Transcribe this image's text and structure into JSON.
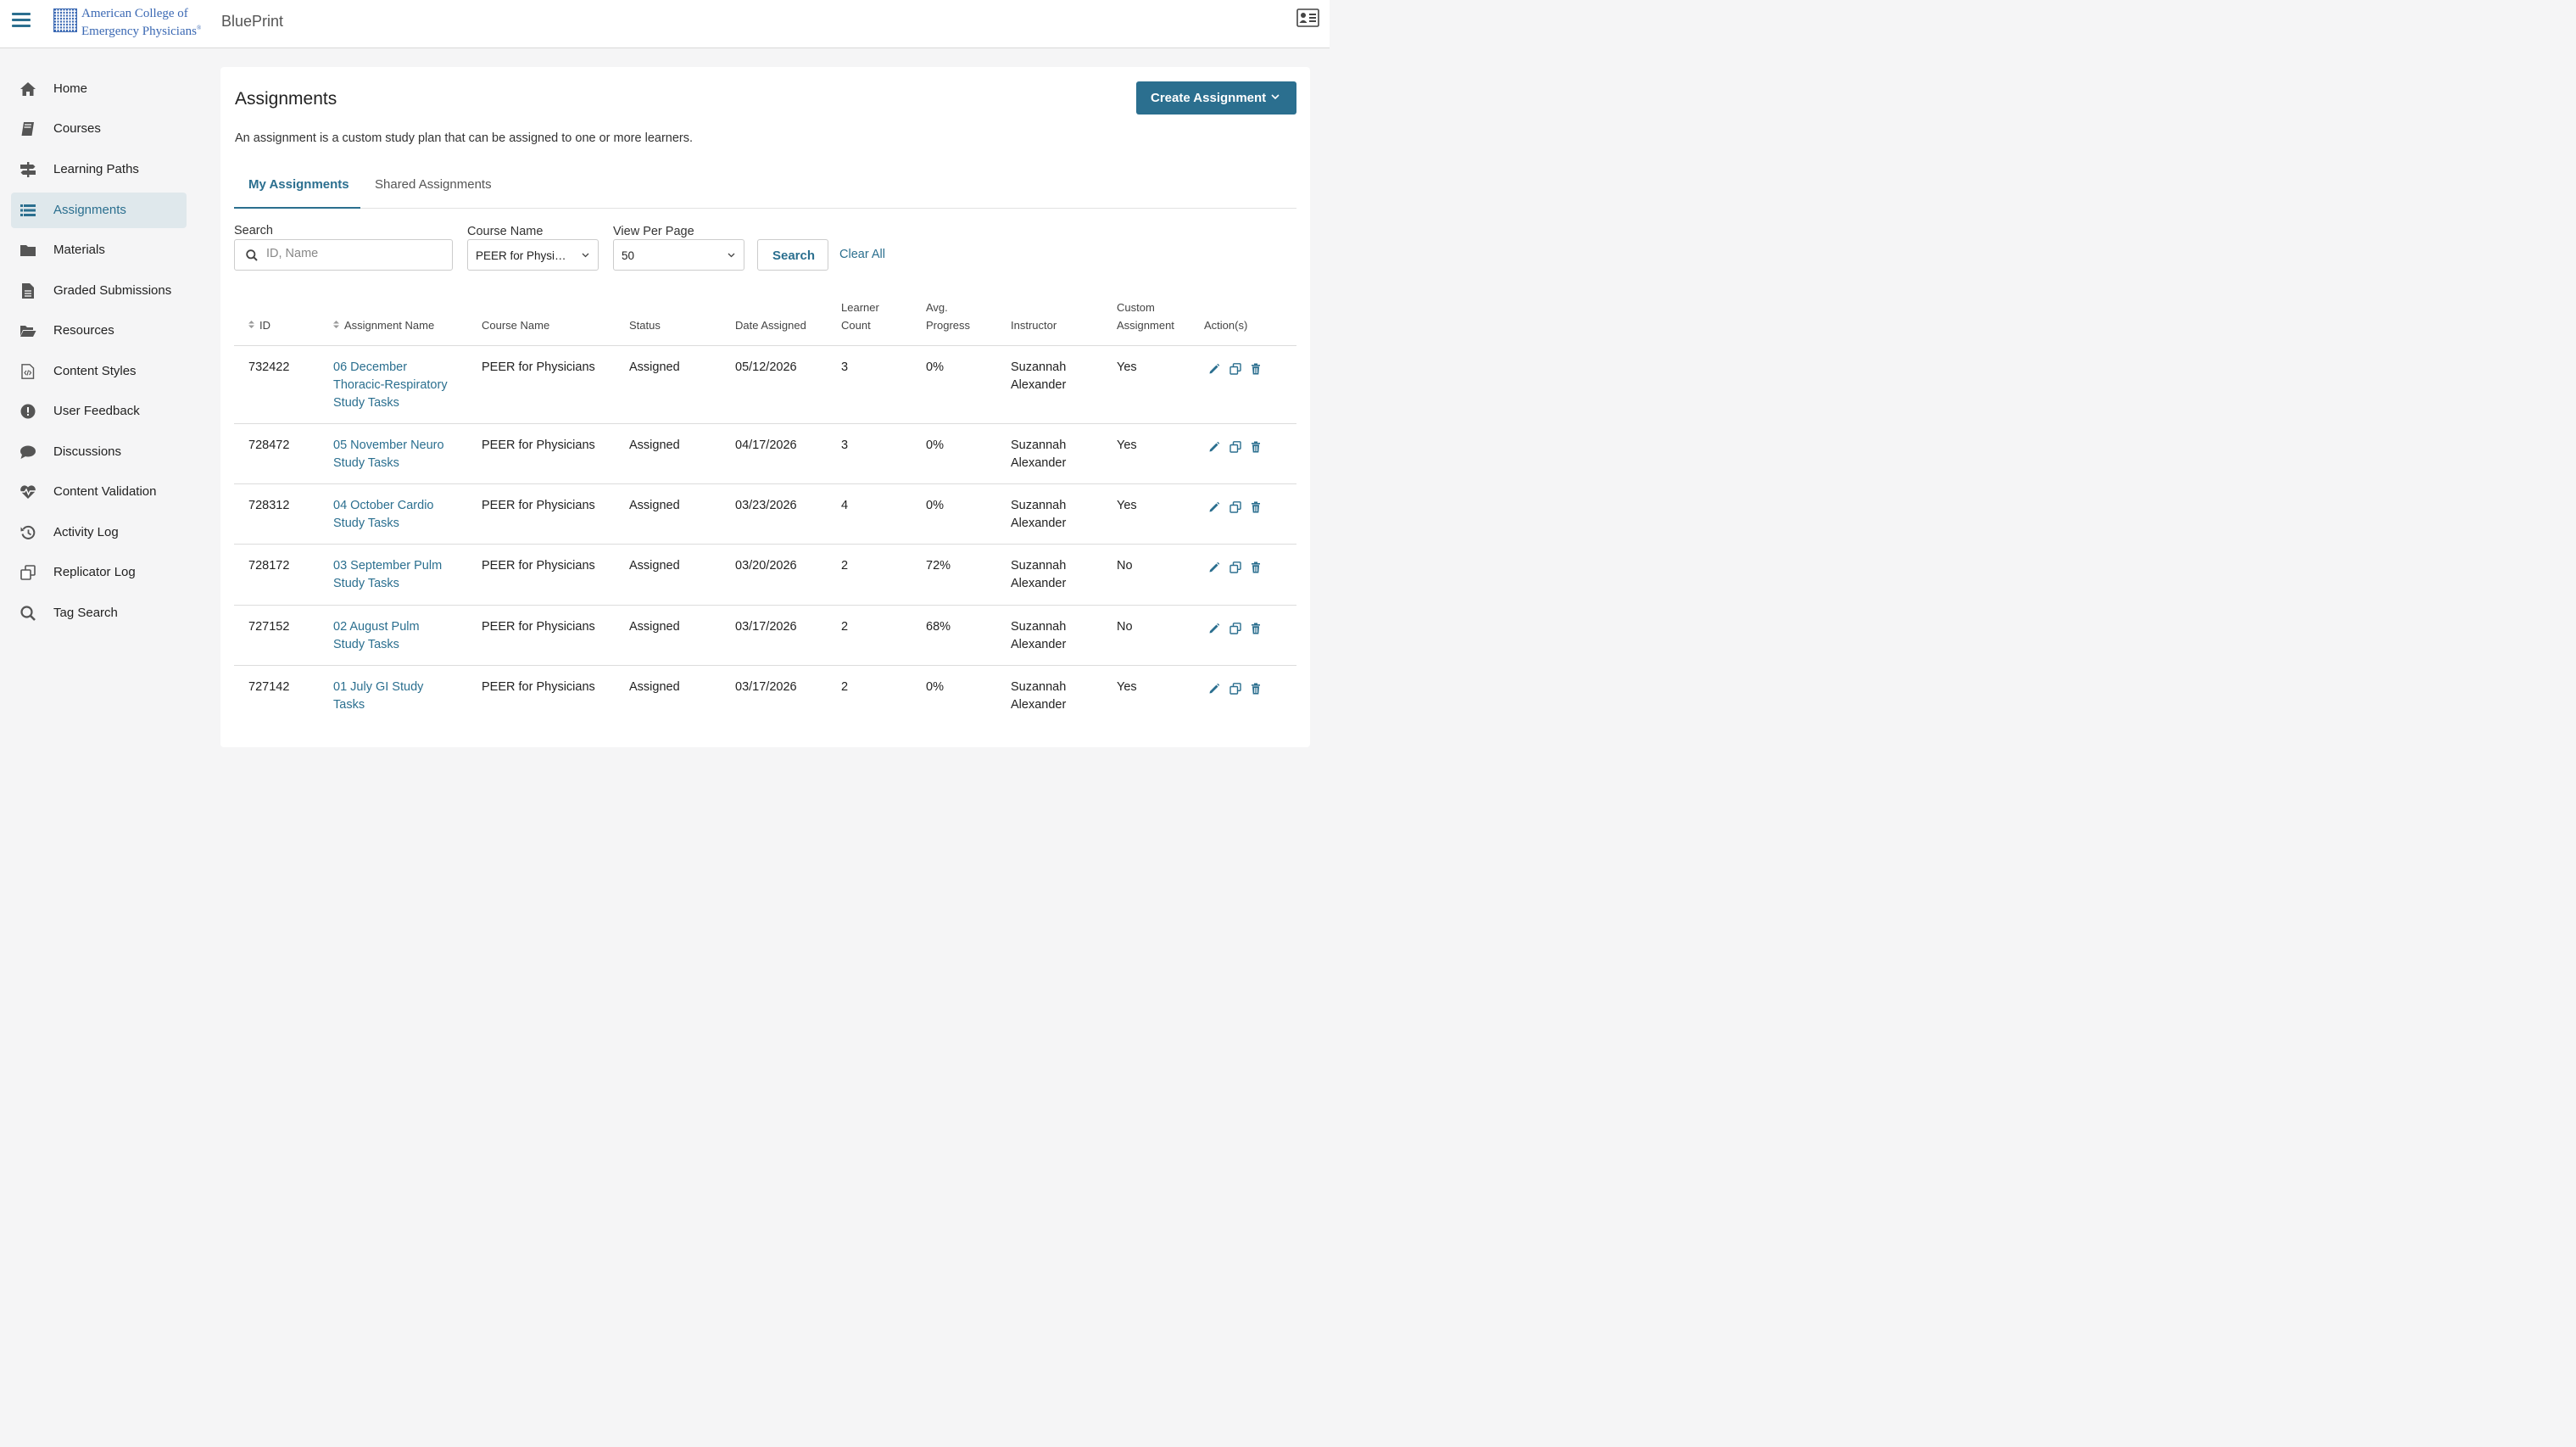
{
  "header": {
    "logo_line1": "American College of",
    "logo_line2": "Emergency Physicians",
    "logo_reg": "®",
    "app_name": "BluePrint"
  },
  "sidebar": {
    "items": [
      {
        "label": "Home",
        "icon": "home-icon"
      },
      {
        "label": "Courses",
        "icon": "book-icon"
      },
      {
        "label": "Learning Paths",
        "icon": "signpost-icon"
      },
      {
        "label": "Assignments",
        "icon": "list-icon",
        "active": true
      },
      {
        "label": "Materials",
        "icon": "folder-icon"
      },
      {
        "label": "Graded Submissions",
        "icon": "document-icon"
      },
      {
        "label": "Resources",
        "icon": "folder-open-icon"
      },
      {
        "label": "Content Styles",
        "icon": "code-file-icon"
      },
      {
        "label": "User Feedback",
        "icon": "exclamation-icon"
      },
      {
        "label": "Discussions",
        "icon": "speech-bubble-icon"
      },
      {
        "label": "Content Validation",
        "icon": "heartbeat-icon"
      },
      {
        "label": "Activity Log",
        "icon": "history-icon"
      },
      {
        "label": "Replicator Log",
        "icon": "copy-icon"
      },
      {
        "label": "Tag Search",
        "icon": "search-icon"
      }
    ]
  },
  "page": {
    "title": "Assignments",
    "description": "An assignment is a custom study plan that can be assigned to one or more learners.",
    "create_button": "Create Assignment"
  },
  "tabs": [
    {
      "label": "My Assignments",
      "active": true
    },
    {
      "label": "Shared Assignments",
      "active": false
    }
  ],
  "filters": {
    "search_label": "Search",
    "search_placeholder": "ID, Name",
    "course_label": "Course Name",
    "course_value": "PEER for Physi…",
    "per_page_label": "View Per Page",
    "per_page_value": "50",
    "search_button": "Search",
    "clear_all": "Clear All"
  },
  "table": {
    "headers": {
      "id": "ID",
      "name": "Assignment Name",
      "course": "Course Name",
      "status": "Status",
      "date": "Date Assigned",
      "learner_1": "Learner",
      "learner_2": "Count",
      "progress_1": "Avg.",
      "progress_2": "Progress",
      "instructor": "Instructor",
      "custom_1": "Custom",
      "custom_2": "Assignment",
      "actions": "Action(s)"
    },
    "rows": [
      {
        "id": "732422",
        "name": [
          "06 December",
          "Thoracic-Respiratory",
          "Study Tasks"
        ],
        "course": "PEER for Physicians",
        "status": "Assigned",
        "date": "05/12/2026",
        "learners": "3",
        "progress": "0%",
        "instructor": [
          "Suzannah",
          "Alexander"
        ],
        "custom": "Yes"
      },
      {
        "id": "728472",
        "name": [
          "05 November Neuro",
          "Study Tasks"
        ],
        "course": "PEER for Physicians",
        "status": "Assigned",
        "date": "04/17/2026",
        "learners": "3",
        "progress": "0%",
        "instructor": [
          "Suzannah",
          "Alexander"
        ],
        "custom": "Yes"
      },
      {
        "id": "728312",
        "name": [
          "04 October Cardio",
          "Study Tasks"
        ],
        "course": "PEER for Physicians",
        "status": "Assigned",
        "date": "03/23/2026",
        "learners": "4",
        "progress": "0%",
        "instructor": [
          "Suzannah",
          "Alexander"
        ],
        "custom": "Yes"
      },
      {
        "id": "728172",
        "name": [
          "03 September Pulm",
          "Study Tasks"
        ],
        "course": "PEER for Physicians",
        "status": "Assigned",
        "date": "03/20/2026",
        "learners": "2",
        "progress": "72%",
        "instructor": [
          "Suzannah",
          "Alexander"
        ],
        "custom": "No"
      },
      {
        "id": "727152",
        "name": [
          "02 August Pulm",
          "Study Tasks"
        ],
        "course": "PEER for Physicians",
        "status": "Assigned",
        "date": "03/17/2026",
        "learners": "2",
        "progress": "68%",
        "instructor": [
          "Suzannah",
          "Alexander"
        ],
        "custom": "No"
      },
      {
        "id": "727142",
        "name": [
          "01 July GI Study",
          "Tasks"
        ],
        "course": "PEER for Physicians",
        "status": "Assigned",
        "date": "03/17/2026",
        "learners": "2",
        "progress": "0%",
        "instructor": [
          "Suzannah",
          "Alexander"
        ],
        "custom": "Yes"
      }
    ],
    "action_icons": [
      "pencil-icon",
      "copy-icon",
      "trash-icon"
    ]
  },
  "colors": {
    "accent": "#2b6f8f",
    "logo_blue": "#3a68b3",
    "active_nav_bg": "#dfe8ec",
    "page_bg": "#f5f5f6"
  }
}
